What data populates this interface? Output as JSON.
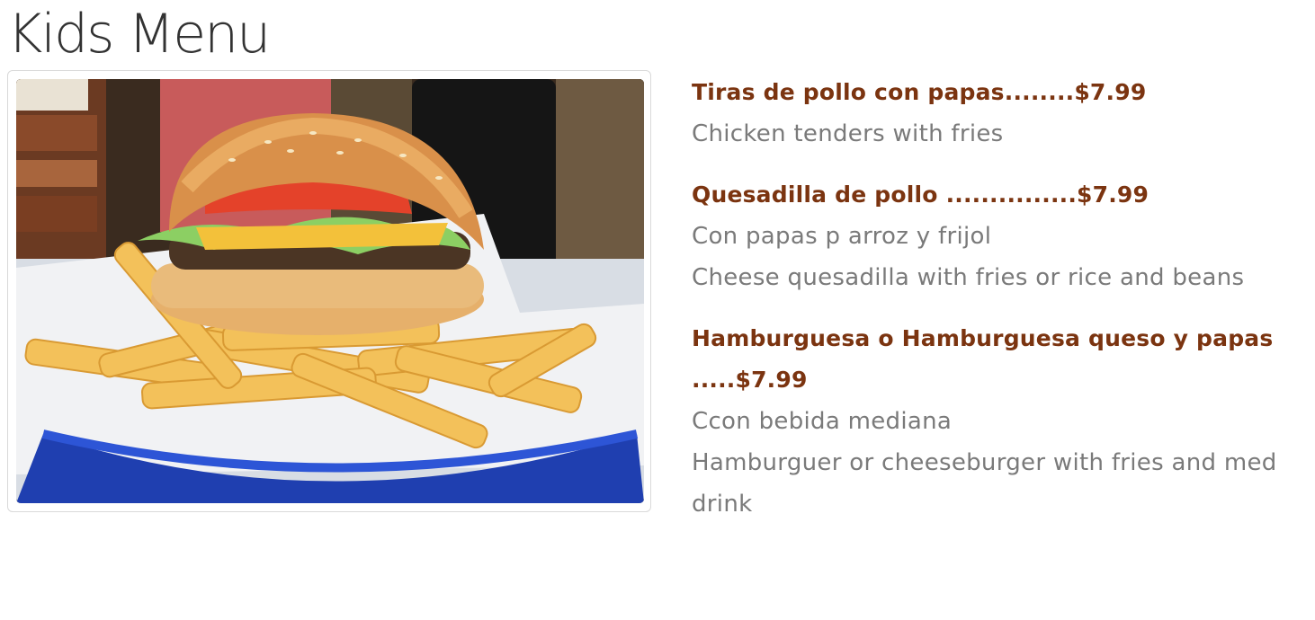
{
  "page": {
    "title": "Kids Menu"
  },
  "photo": {
    "subject": "hamburger-with-fries-in-basket"
  },
  "menu": {
    "items": [
      {
        "name": "Tiras de pollo con papas........$7.99",
        "descriptions": [
          "Chicken tenders with fries"
        ]
      },
      {
        "name": "Quesadilla de pollo ...............$7.99",
        "descriptions": [
          "Con papas p arroz y frijol",
          "Cheese quesadilla with fries or rice and beans"
        ]
      },
      {
        "name": "Hamburguesa o Hamburguesa queso y papas .....$7.99",
        "descriptions": [
          "Ccon bebida mediana",
          "Hamburguer or cheeseburger with fries and med drink"
        ]
      }
    ]
  },
  "colors": {
    "item_name": "#7b3410",
    "item_desc": "#7a7a7a",
    "title": "#333333",
    "basket": "#1f3fb0"
  }
}
